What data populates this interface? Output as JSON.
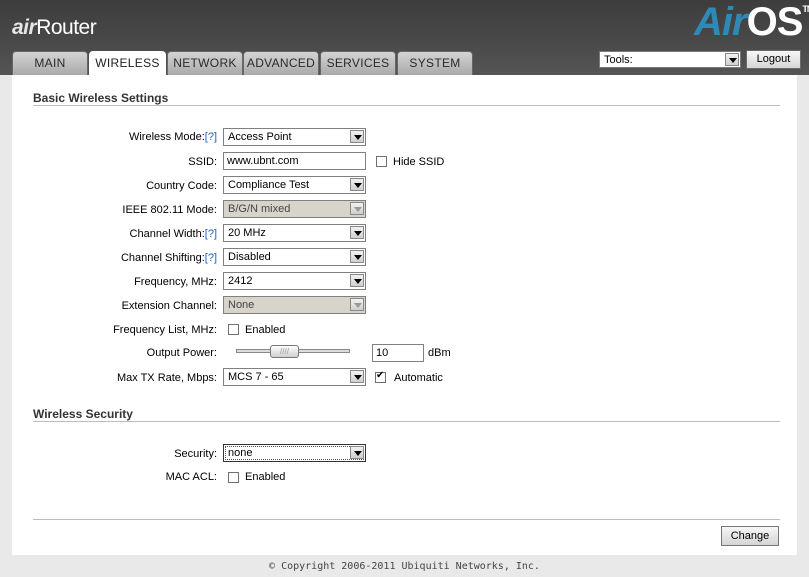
{
  "brand": {
    "left_air": "air",
    "left_router": "Router",
    "right_air": "Air",
    "right_os": "OS",
    "tm": "TM"
  },
  "tabs": [
    {
      "label": "MAIN",
      "active": false
    },
    {
      "label": "WIRELESS",
      "active": true
    },
    {
      "label": "NETWORK",
      "active": false
    },
    {
      "label": "ADVANCED",
      "active": false
    },
    {
      "label": "SERVICES",
      "active": false
    },
    {
      "label": "SYSTEM",
      "active": false
    }
  ],
  "tools": {
    "value": "Tools:"
  },
  "logout_label": "Logout",
  "basic": {
    "title": "Basic Wireless Settings",
    "wireless_mode": {
      "label": "Wireless Mode:",
      "help": "[?]",
      "value": "Access Point"
    },
    "ssid": {
      "label": "SSID:",
      "value": "www.ubnt.com",
      "hide_label": "Hide SSID",
      "hide_checked": false
    },
    "country_code": {
      "label": "Country Code:",
      "value": "Compliance Test"
    },
    "ieee_mode": {
      "label": "IEEE 802.11 Mode:",
      "value": "B/G/N mixed",
      "disabled": true
    },
    "channel_width": {
      "label": "Channel Width:",
      "help": "[?]",
      "value": "20 MHz"
    },
    "channel_shifting": {
      "label": "Channel Shifting:",
      "help": "[?]",
      "value": "Disabled"
    },
    "frequency": {
      "label": "Frequency, MHz:",
      "value": "2412"
    },
    "extension_channel": {
      "label": "Extension Channel:",
      "value": "None",
      "disabled": true
    },
    "frequency_list": {
      "label": "Frequency List, MHz:",
      "cb_label": "Enabled",
      "checked": false
    },
    "output_power": {
      "label": "Output Power:",
      "value": "10",
      "unit": "dBm",
      "slider_fraction": 0.4
    },
    "max_tx_rate": {
      "label": "Max TX Rate, Mbps:",
      "value": "MCS 7 - 65",
      "auto_label": "Automatic",
      "auto_checked": true
    }
  },
  "security": {
    "title": "Wireless Security",
    "security": {
      "label": "Security:",
      "value": "none"
    },
    "mac_acl": {
      "label": "MAC ACL:",
      "cb_label": "Enabled",
      "checked": false
    }
  },
  "change_label": "Change",
  "footer": "© Copyright 2006-2011 Ubiquiti Networks, Inc."
}
